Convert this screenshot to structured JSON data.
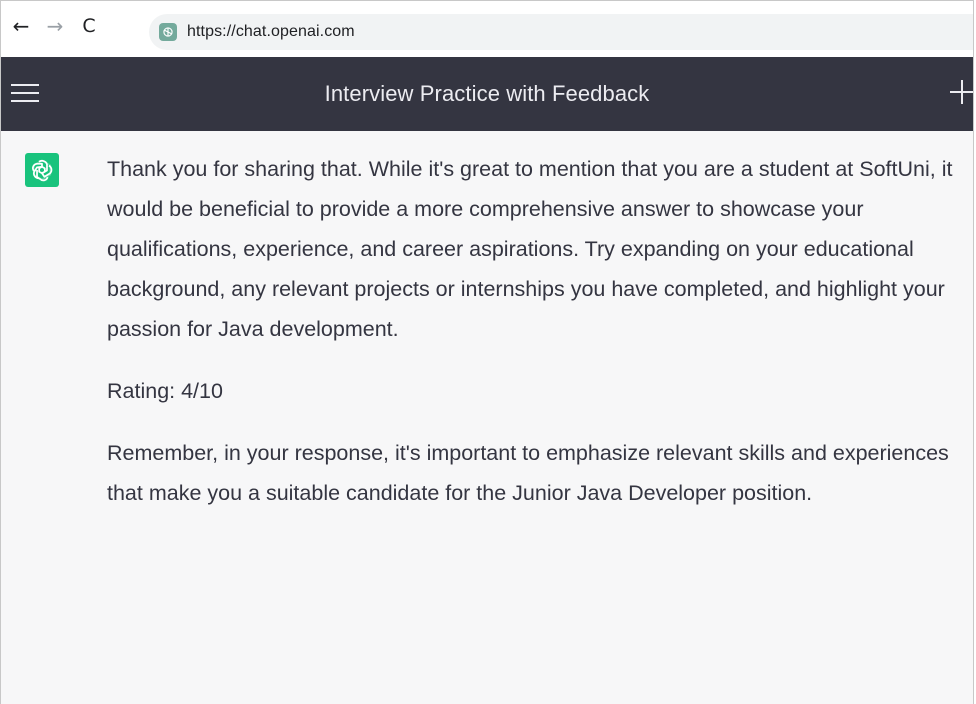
{
  "browser": {
    "back_icon": "arrow-left-icon",
    "forward_icon": "arrow-right-icon",
    "reload_icon": "reload-icon",
    "back_glyph": "←",
    "forward_glyph": "→",
    "reload_glyph": "C",
    "url": "https://chat.openai.com"
  },
  "header": {
    "title": "Interview Practice with Feedback",
    "menu_icon": "hamburger-menu-icon",
    "new_chat_icon": "plus-icon"
  },
  "message": {
    "author": "assistant",
    "avatar_icon": "openai-logo-icon",
    "paragraphs": [
      "Thank you for sharing that. While it's great to mention that you are a student at SoftUni, it would be beneficial to provide a more comprehensive answer to showcase your qualifications, experience, and career aspirations. Try expanding on your educational background, any relevant projects or internships you have completed, and highlight your passion for Java development.",
      "Rating: 4/10",
      "Remember, in your response, it's important to emphasize relevant skills and experiences that make you a suitable candidate for the Junior Java Developer position."
    ]
  },
  "colors": {
    "header_bg": "#343541",
    "avatar_bg": "#19c37d",
    "content_bg": "#f7f7f8",
    "text": "#343541"
  }
}
